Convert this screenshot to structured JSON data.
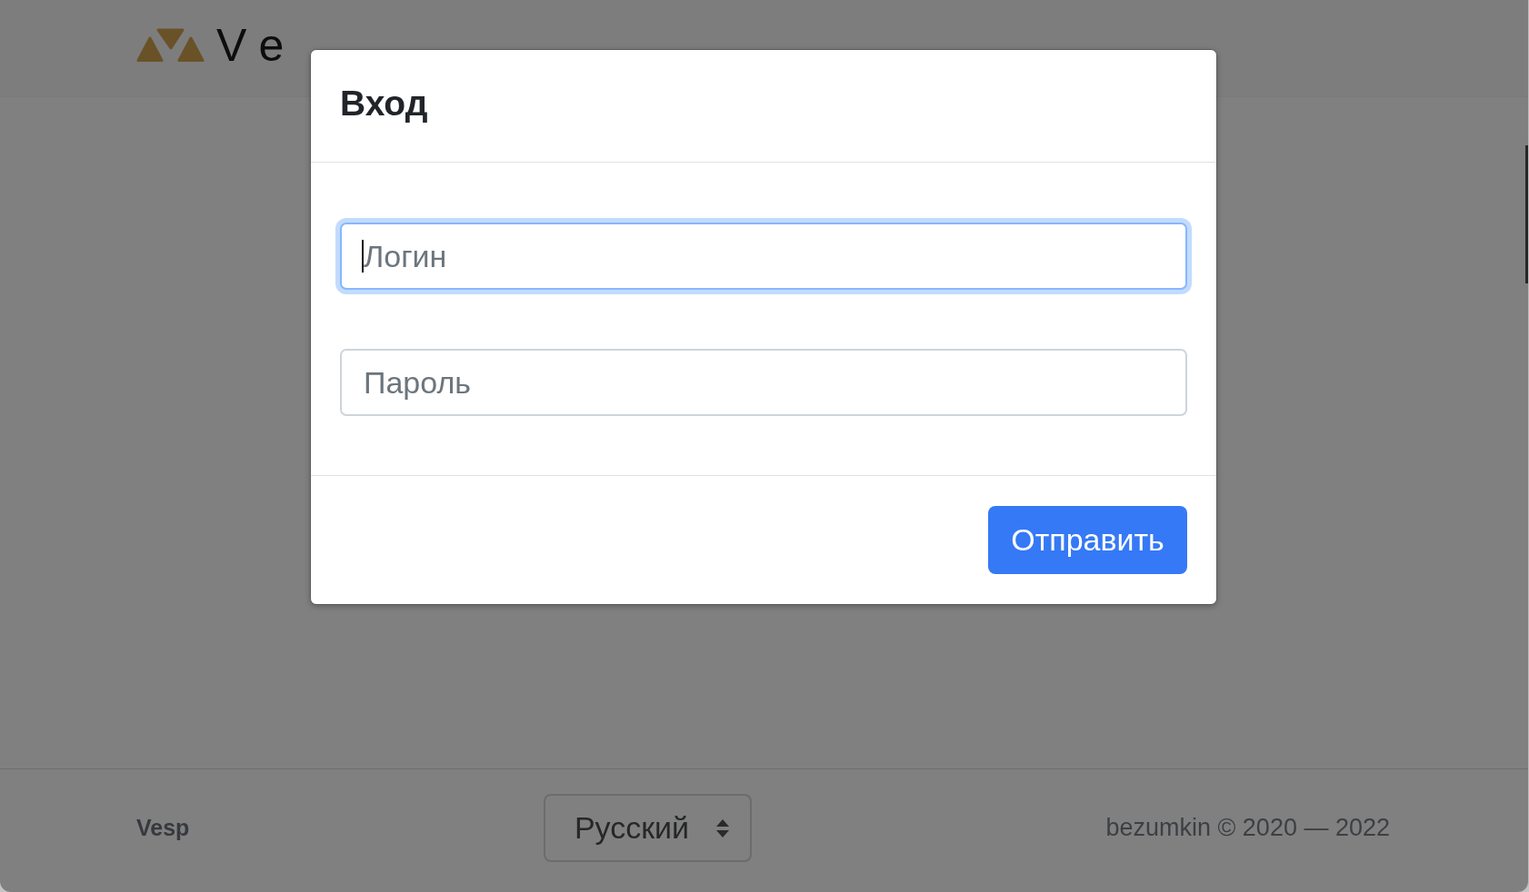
{
  "header": {
    "logo_text": "Ve"
  },
  "dialog": {
    "title": "Вход",
    "fields": [
      {
        "placeholder": "Логин",
        "focused": true
      },
      {
        "placeholder": "Пароль",
        "focused": false
      }
    ],
    "submit_button": "Отправить"
  },
  "footer": {
    "brand": "Vesp",
    "language_select": {
      "value": "Русский"
    },
    "copyright": "bezumkin © 2020 — 2022"
  }
}
